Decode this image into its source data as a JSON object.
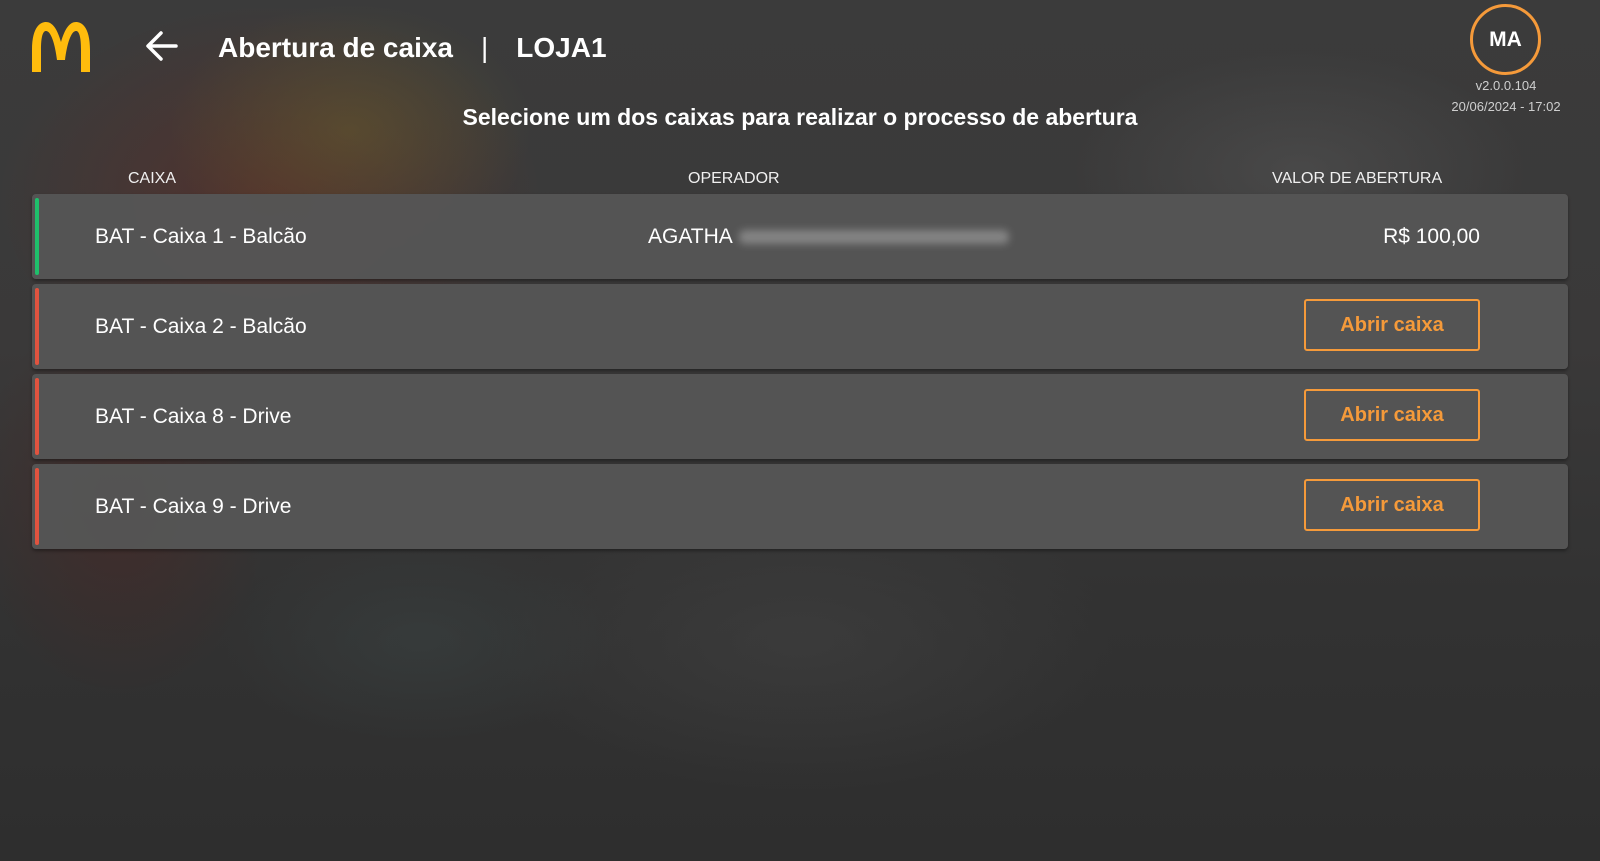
{
  "colors": {
    "brand_yellow": "#ffbc0d",
    "accent_orange": "#f59a3a",
    "status_open": "#1fbf6b",
    "status_closed": "#e0533f"
  },
  "header": {
    "logo_icon": "mcdonalds-arches-logo",
    "back_icon": "arrow-left-icon",
    "title": "Abertura de caixa",
    "separator": "|",
    "store": "LOJA1"
  },
  "user": {
    "initials": "MA",
    "version": "v2.0.0.104",
    "datetime": "20/06/2024 - 17:02"
  },
  "subtitle": "Selecione um dos caixas para realizar o processo de abertura",
  "columns": {
    "caixa": "CAIXA",
    "operador": "OPERADOR",
    "valor": "VALOR DE ABERTURA"
  },
  "registers": [
    {
      "name": "BAT - Caixa 1 - Balcão",
      "status": "open",
      "operator": "AGATHA",
      "value": "R$ 100,00"
    },
    {
      "name": "BAT - Caixa 2 - Balcão",
      "status": "closed",
      "action_label": "Abrir caixa"
    },
    {
      "name": "BAT - Caixa 8 - Drive",
      "status": "closed",
      "action_label": "Abrir caixa"
    },
    {
      "name": "BAT - Caixa 9 - Drive",
      "status": "closed",
      "action_label": "Abrir caixa"
    }
  ]
}
